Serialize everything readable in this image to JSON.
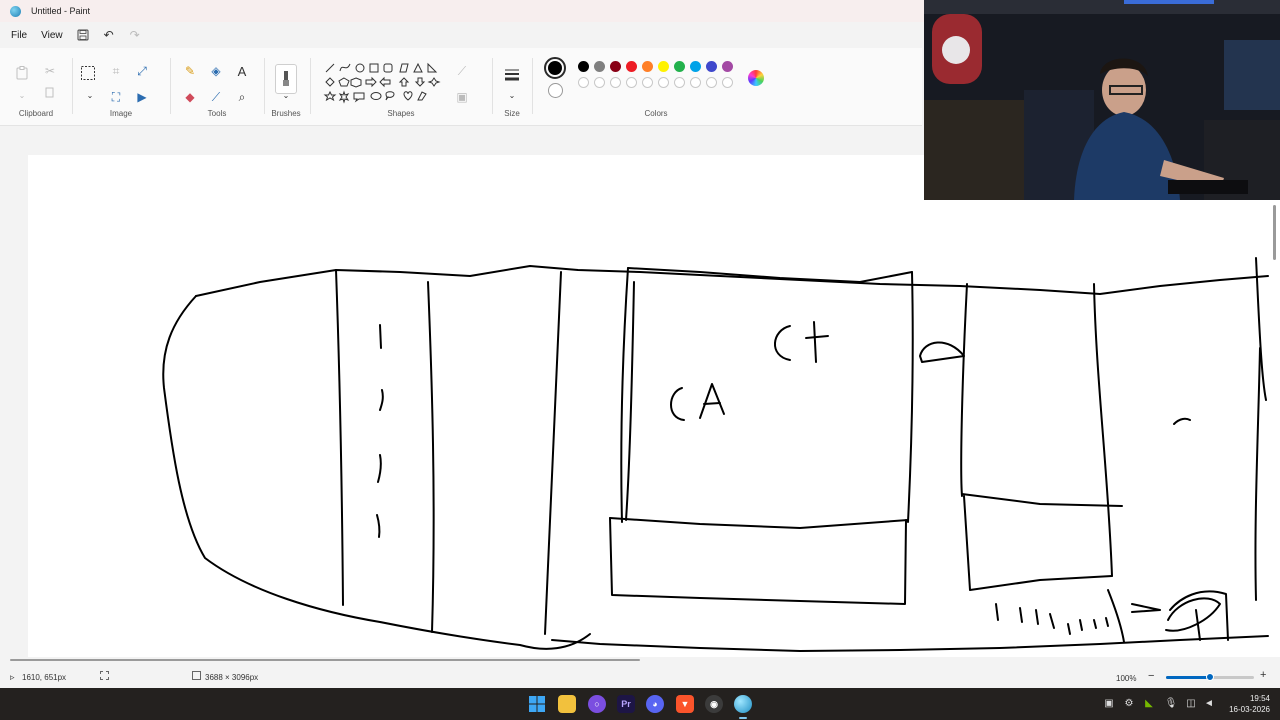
{
  "window": {
    "title": "Untitled - Paint"
  },
  "menu": {
    "file": "File",
    "view": "View"
  },
  "ribbon": {
    "groups": {
      "clipboard": "Clipboard",
      "image": "Image",
      "tools": "Tools",
      "brushes": "Brushes",
      "shapes": "Shapes",
      "size": "Size",
      "colors": "Colors"
    },
    "text_tool_glyph": "A",
    "primary_color": "#000000",
    "secondary_color": "#ffffff",
    "palette_row1": [
      "#000000",
      "#7f7f7f",
      "#880015",
      "#ed1c24",
      "#ff7f27",
      "#fff200",
      "#22b14c",
      "#00a2e8",
      "#3f48cc",
      "#a349a4"
    ],
    "palette_row2": [
      "#ffffff",
      "#c3c3c3",
      "#b97a57",
      "#ffaec9",
      "#ffc90e",
      "#efe4b0",
      "#b5e61d",
      "#99d9ea",
      "#7092be",
      "#c8bfe7"
    ]
  },
  "status": {
    "cursor_pos": "1610, 651px",
    "canvas_size": "3688 × 3096px",
    "zoom": "100%",
    "zoom_level": 0.5
  },
  "taskbar": {
    "time": "19:54",
    "date": "16-03-2026"
  }
}
